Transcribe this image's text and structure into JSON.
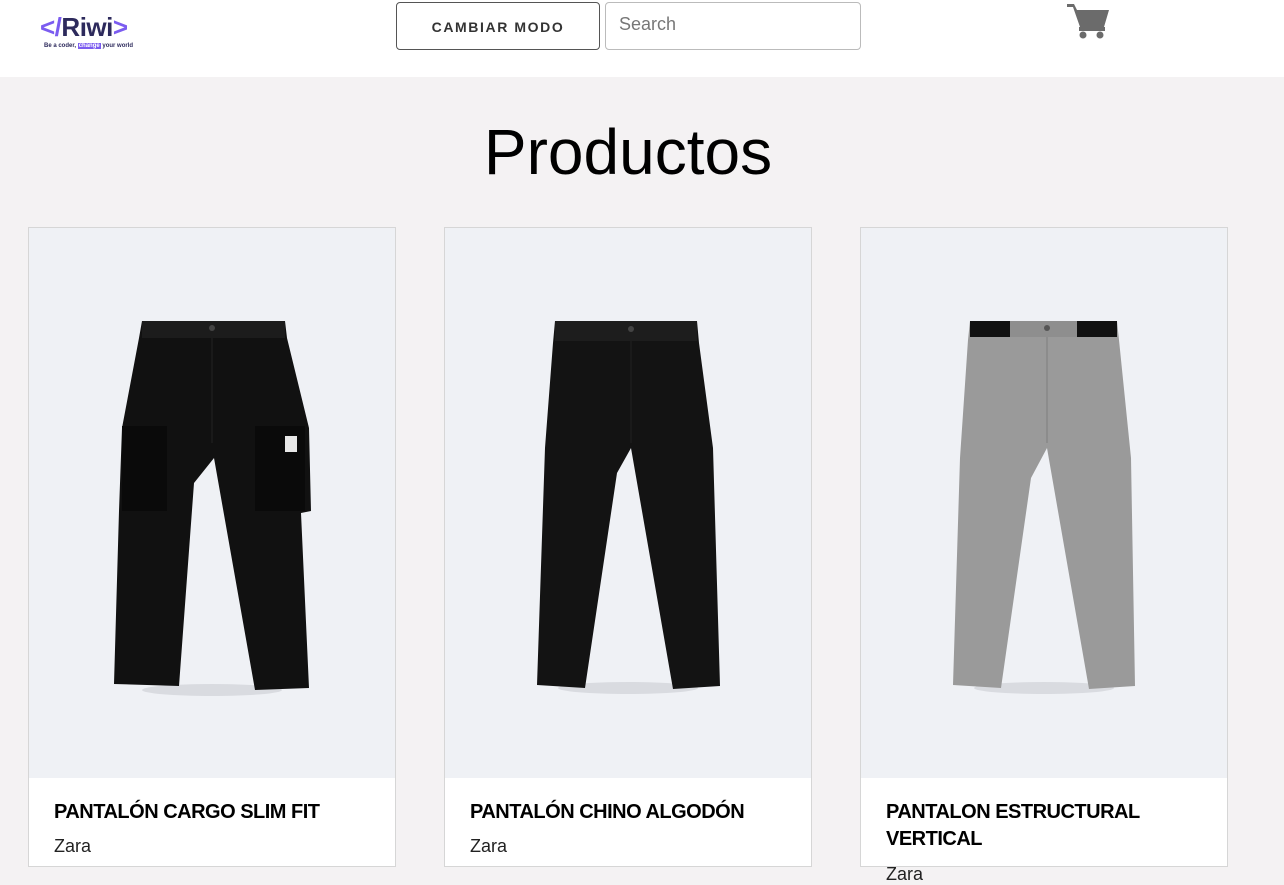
{
  "header": {
    "logo_text": "</Riwi>",
    "logo_tagline_pre": "Be a coder,",
    "logo_tagline_hl": "change",
    "logo_tagline_post": "your world",
    "mode_button_label": "CAMBIAR MODO",
    "search_placeholder": "Search",
    "cart_icon": "cart-icon"
  },
  "page_title": "Productos",
  "products": [
    {
      "name": "PANTALÓN CARGO SLIM FIT",
      "brand": "Zara",
      "color": "#111111"
    },
    {
      "name": "PANTALÓN CHINO ALGODÓN",
      "brand": "Zara",
      "color": "#131313"
    },
    {
      "name": "PANTALON ESTRUCTURAL VERTICAL",
      "brand": "Zara",
      "color": "#9a9a9a"
    }
  ]
}
